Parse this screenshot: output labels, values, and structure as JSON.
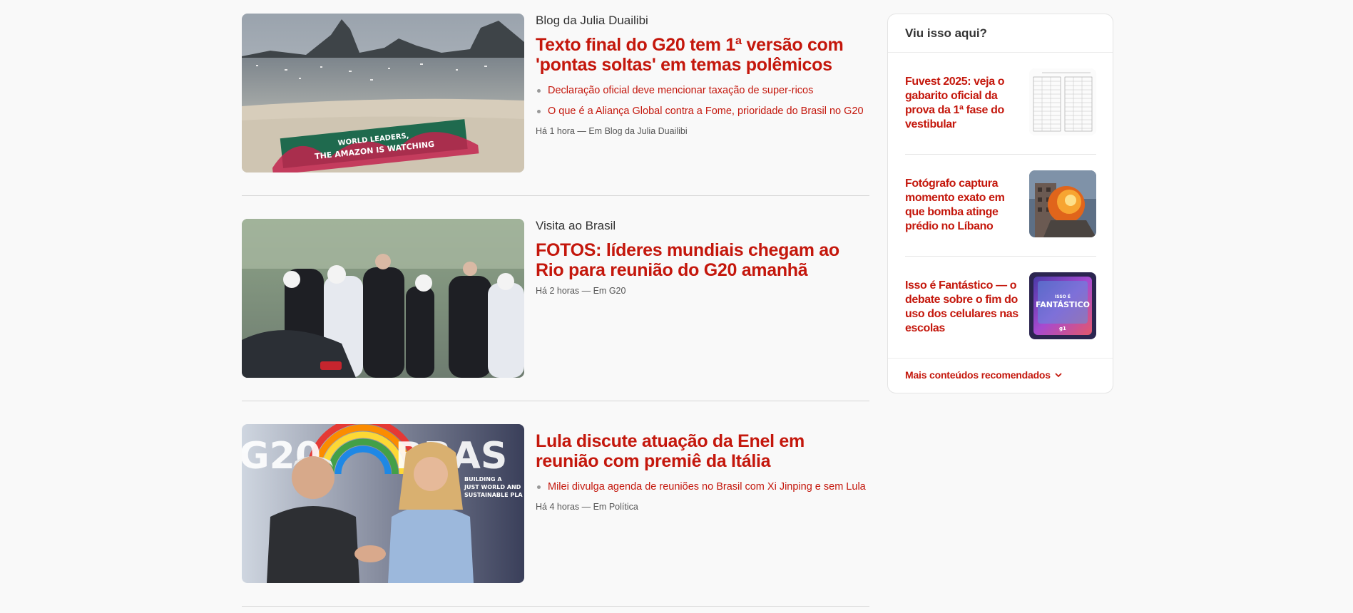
{
  "feed": {
    "items": [
      {
        "kicker": "Blog da Julia Duailibi",
        "title": "Texto final do G20 tem 1ª versão com 'pontas soltas' em temas polêmicos",
        "bullets": [
          "Declaração oficial deve mencionar taxação de super-ricos",
          "O que é a Aliança Global contra a Fome, prioridade do Brasil no G20"
        ],
        "meta": "Há 1 hora — Em Blog da Julia Duailibi",
        "image_text": [
          "WORLD LEADERS,",
          "THE AMAZON IS WATCHING"
        ]
      },
      {
        "kicker": "Visita ao Brasil",
        "title": "FOTOS: líderes mundiais chegam ao Rio para reunião do G20 amanhã",
        "bullets": [],
        "meta": "Há 2 horas — Em G20"
      },
      {
        "kicker": "",
        "title": "Lula discute atuação da Enel em reunião com premiê da Itália",
        "bullets": [
          "Milei divulga agenda de reuniões no Brasil com Xi Jinping e sem Lula"
        ],
        "meta": "Há 4 horas — Em Política",
        "image_text": [
          "G20",
          "BRAS",
          "BUILDING A",
          "JUST WORLD AND",
          "SUSTAINABLE PLA"
        ]
      }
    ]
  },
  "sidebar": {
    "title": "Viu isso aqui?",
    "items": [
      {
        "title": "Fuvest 2025: veja o gabarito oficial da prova da 1ª fase do vestibular"
      },
      {
        "title": "Fotógrafo captura momento exato em que bomba atinge prédio no Líbano"
      },
      {
        "title": "Isso é Fantástico — o debate sobre o fim do uso dos celulares nas escolas",
        "image_text": [
          "ISSO É",
          "FANTÁSTICO",
          "g1"
        ]
      }
    ],
    "more_label": "Mais conteúdos recomendados",
    "more_icon": "chevron-down-icon"
  },
  "colors": {
    "accent": "#c4170c",
    "background": "#f9f9f9"
  }
}
